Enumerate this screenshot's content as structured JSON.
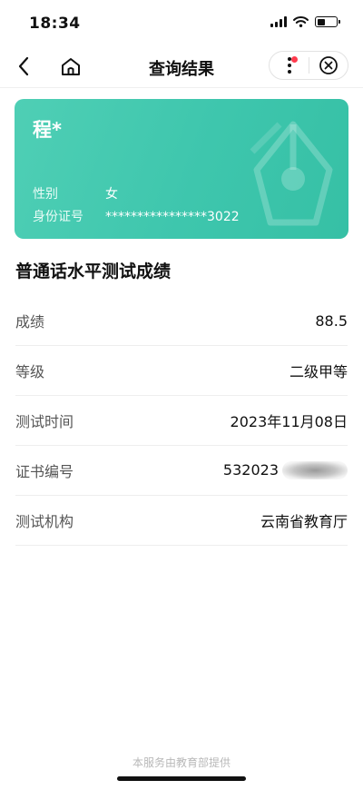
{
  "status_bar": {
    "time": "18:34",
    "battery_level": 0.45
  },
  "nav": {
    "title": "查询结果",
    "icons": [
      "chevron-left-icon",
      "home-icon",
      "more-vertical-icon",
      "close-circle-icon"
    ],
    "accent_dot_color": "#ff3b4e"
  },
  "card": {
    "name": "程*",
    "gender_label": "性别",
    "gender_value": "女",
    "id_label": "身份证号",
    "id_value": "****************3022",
    "background_color": "#3ec6ad"
  },
  "section_title": "普通话水平测试成绩",
  "results": [
    {
      "label": "成绩",
      "value": "88.5"
    },
    {
      "label": "等级",
      "value": "二级甲等"
    },
    {
      "label": "测试时间",
      "value": "2023年11月08日"
    },
    {
      "label": "证书编号",
      "value": "532023"
    },
    {
      "label": "测试机构",
      "value": "云南省教育厅"
    }
  ],
  "footer": "本服务由教育部提供"
}
